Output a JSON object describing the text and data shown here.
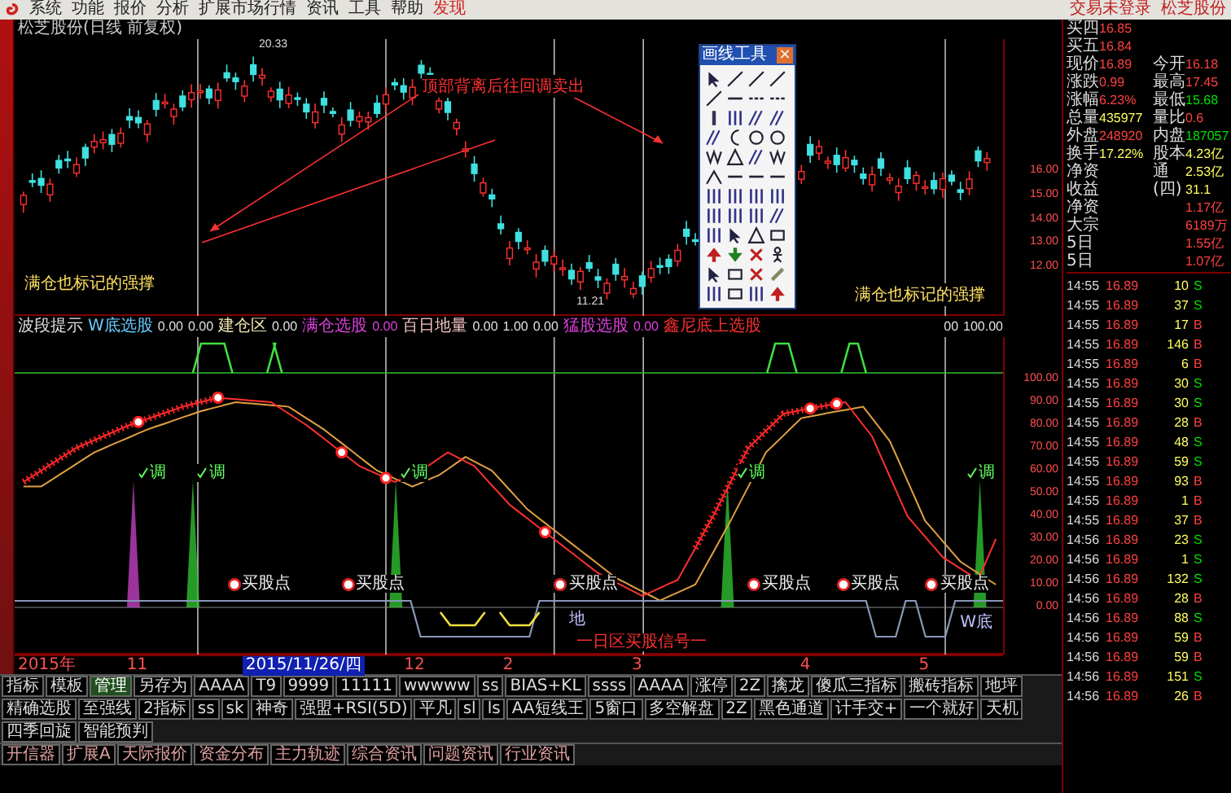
{
  "menu_bar": {
    "items": [
      {
        "label": "系统",
        "highlight": false
      },
      {
        "label": "功能",
        "highlight": false
      },
      {
        "label": "报价",
        "highlight": false
      },
      {
        "label": "分析",
        "highlight": false
      },
      {
        "label": "扩展市场行情",
        "highlight": false
      },
      {
        "label": "资讯",
        "highlight": false
      },
      {
        "label": "工具",
        "highlight": false
      },
      {
        "label": "帮助",
        "highlight": false
      },
      {
        "label": "发现",
        "highlight": true
      }
    ],
    "right": [
      "交易未登录",
      "松芝股份"
    ]
  },
  "price_chart": {
    "title": "松芝股份(日线 前复权)",
    "high_label": "20.33",
    "low_label": "11.21",
    "annotations": [
      {
        "text": "满仓也标记的强撑",
        "kind": "note"
      },
      {
        "text": "顶部背离后往回调卖出",
        "kind": "alert"
      },
      {
        "text": "满仓也标记的强撑",
        "kind": "note"
      }
    ],
    "axis": [
      "16.00",
      "15.00",
      "14.00",
      "13.00",
      "12.00"
    ]
  },
  "indicator_header": [
    {
      "text": "波段提示",
      "kind": "name",
      "color": "#e0e0e0"
    },
    {
      "text": "W底选股",
      "kind": "name",
      "color": "#66ccff"
    },
    {
      "text": "0.00",
      "kind": "value",
      "color": "#e0e0e0"
    },
    {
      "text": "0.00",
      "kind": "value",
      "color": "#e0e0e0"
    },
    {
      "text": "建仓区",
      "kind": "name",
      "color": "#f0e6b0"
    },
    {
      "text": "0.00",
      "kind": "value",
      "color": "#e0e0e0"
    },
    {
      "text": "满仓选股",
      "kind": "name",
      "color": "#e040e0"
    },
    {
      "text": "0.00",
      "kind": "value",
      "color": "#e040e0"
    },
    {
      "text": "百日地量",
      "kind": "name",
      "color": "#f0c0c0"
    },
    {
      "text": "0.00",
      "kind": "value",
      "color": "#e0e0e0"
    },
    {
      "text": "1.00",
      "kind": "value",
      "color": "#e0e0e0"
    },
    {
      "text": "0.00",
      "kind": "value",
      "color": "#e0e0e0"
    },
    {
      "text": "猛股选股",
      "kind": "name",
      "color": "#e040e0"
    },
    {
      "text": "0.00",
      "kind": "value",
      "color": "#e040e0"
    },
    {
      "text": "鑫尼底上选股",
      "kind": "name",
      "color": "#ff3030"
    },
    {
      "text": "00",
      "kind": "value",
      "color": "#e0e0e0"
    },
    {
      "text": "100.00",
      "kind": "value",
      "color": "#e0e0e0"
    }
  ],
  "indicator": {
    "labels": [
      {
        "text": "调",
        "kind": "signal"
      },
      {
        "text": "调",
        "kind": "signal"
      },
      {
        "text": "调",
        "kind": "signal"
      },
      {
        "text": "调",
        "kind": "signal"
      },
      {
        "text": "调",
        "kind": "signal"
      },
      {
        "text": "买股点",
        "kind": "buy"
      },
      {
        "text": "买股点",
        "kind": "buy"
      },
      {
        "text": "买股点",
        "kind": "buy"
      },
      {
        "text": "买股点",
        "kind": "buy"
      },
      {
        "text": "买股点",
        "kind": "buy"
      },
      {
        "text": "买股点",
        "kind": "buy"
      },
      {
        "text": "地",
        "kind": "floor"
      },
      {
        "text": "W底",
        "kind": "floor"
      }
    ],
    "footer": "一日区买股信号一",
    "axis": [
      "100.00",
      "90.00",
      "80.00",
      "70.00",
      "60.00",
      "50.00",
      "40.00",
      "30.00",
      "20.00",
      "10.00",
      "0.00"
    ]
  },
  "date_axis": [
    {
      "text": "2015年",
      "selected": false
    },
    {
      "text": "11",
      "selected": false
    },
    {
      "text": "2015/11/26/四",
      "selected": true
    },
    {
      "text": "12",
      "selected": false
    },
    {
      "text": "2",
      "selected": false
    },
    {
      "text": "3",
      "selected": false
    },
    {
      "text": "4",
      "selected": false
    },
    {
      "text": "5",
      "selected": false
    }
  ],
  "drawing_tools": {
    "title": "画线工具",
    "close": "×"
  },
  "toolbar": [
    {
      "label": "指标",
      "selected": false
    },
    {
      "label": "模板",
      "selected": false
    },
    {
      "label": "管理",
      "selected": true
    },
    {
      "label": "另存为",
      "selected": false
    },
    {
      "label": "AAAA",
      "selected": false
    },
    {
      "label": "T9",
      "selected": false
    },
    {
      "label": "9999",
      "selected": false
    },
    {
      "label": "11111",
      "selected": false
    },
    {
      "label": "wwwww",
      "selected": false
    },
    {
      "label": "ss",
      "selected": false
    },
    {
      "label": "BIAS+KL",
      "selected": false
    },
    {
      "label": "ssss",
      "selected": false
    },
    {
      "label": "AAAA",
      "selected": false
    },
    {
      "label": "涨停",
      "selected": false
    },
    {
      "label": "2Z",
      "selected": false
    },
    {
      "label": "擒龙",
      "selected": false
    },
    {
      "label": "傻瓜三指标",
      "selected": false
    },
    {
      "label": "搬砖指标",
      "selected": false
    },
    {
      "label": "地坪",
      "selected": false
    },
    {
      "label": "精确选股",
      "selected": false
    },
    {
      "label": "至强线",
      "selected": false
    },
    {
      "label": "2指标",
      "selected": false
    },
    {
      "label": "ss",
      "selected": false
    },
    {
      "label": "sk",
      "selected": false
    },
    {
      "label": "神奇",
      "selected": false
    },
    {
      "label": "强盟+RSI(5D)",
      "selected": false
    },
    {
      "label": "平凡",
      "selected": false
    },
    {
      "label": "sl",
      "selected": false
    },
    {
      "label": "ls",
      "selected": false
    },
    {
      "label": "AA短线王",
      "selected": false
    },
    {
      "label": "5窗口",
      "selected": false
    },
    {
      "label": "多空解盘",
      "selected": false
    },
    {
      "label": "2Z",
      "selected": false
    },
    {
      "label": "黑色通道",
      "selected": false
    },
    {
      "label": "计手交+",
      "selected": false
    },
    {
      "label": "一个就好",
      "selected": false
    },
    {
      "label": "天机",
      "selected": false
    },
    {
      "label": "四季回旋",
      "selected": false
    },
    {
      "label": "智能预判",
      "selected": false
    }
  ],
  "bottom_tabs": [
    "开信器",
    "扩展A",
    "天际报价",
    "资金分布",
    "主力轨迹",
    "综合资讯",
    "问题资讯",
    "行业资讯"
  ],
  "quote": [
    {
      "items": [
        {
          "label": "买四",
          "value": "16.85",
          "color": "#ff4040"
        }
      ]
    },
    {
      "items": [
        {
          "label": "买五",
          "value": "16.84",
          "color": "#ff4040"
        }
      ]
    },
    {
      "items": [
        {
          "label": "现价",
          "value": "16.89",
          "color": "#ff4040"
        },
        {
          "label": "今开",
          "value": "16.18",
          "color": "#ff4040"
        }
      ]
    },
    {
      "items": [
        {
          "label": "涨跌",
          "value": "0.99",
          "color": "#ff4040"
        },
        {
          "label": "最高",
          "value": "17.45",
          "color": "#ff4040"
        }
      ]
    },
    {
      "items": [
        {
          "label": "涨幅",
          "value": "6.23%",
          "color": "#ff4040"
        },
        {
          "label": "最低",
          "value": "15.68",
          "color": "#00e000"
        }
      ]
    },
    {
      "items": [
        {
          "label": "总量",
          "value": "435977",
          "color": "#ffff60"
        },
        {
          "label": "量比",
          "value": "0.6",
          "color": "#ff4040"
        }
      ]
    },
    {
      "items": [
        {
          "label": "外盘",
          "value": "248920",
          "color": "#ff4040"
        },
        {
          "label": "内盘",
          "value": "187057",
          "color": "#00e000"
        }
      ]
    },
    {
      "items": [
        {
          "label": "换手",
          "value": "17.22%",
          "color": "#ffff60"
        },
        {
          "label": "股本",
          "value": "4.23亿",
          "color": "#ffff60"
        }
      ]
    },
    {
      "items": [
        {
          "label": "净资"
        },
        {
          "label": "通",
          "value": "2.53亿",
          "color": "#ffff60"
        }
      ]
    },
    {
      "items": [
        {
          "label": "收益"
        },
        {
          "label": "(四)",
          "value": "31.1",
          "color": "#ffff60"
        }
      ]
    },
    {
      "items": [
        {
          "label": "净资"
        },
        {
          "value": "1.17亿",
          "color": "#ff4040"
        }
      ]
    },
    {
      "items": [
        {
          "label": "大宗"
        },
        {
          "value": "6189万",
          "color": "#ff4040"
        }
      ]
    },
    {
      "items": [
        {
          "label": "5日"
        },
        {
          "value": "1.55亿",
          "color": "#ff4040"
        }
      ]
    },
    {
      "items": [
        {
          "label": "5日"
        },
        {
          "value": "1.07亿",
          "color": "#ff4040"
        }
      ]
    }
  ],
  "ticks": [
    {
      "time": "14:55",
      "price": "16.89",
      "volume": "10",
      "side": "S",
      "buy": false
    },
    {
      "time": "14:55",
      "price": "16.89",
      "volume": "37",
      "side": "S",
      "buy": false
    },
    {
      "time": "14:55",
      "price": "16.89",
      "volume": "17",
      "side": "B",
      "buy": true
    },
    {
      "time": "14:55",
      "price": "16.89",
      "volume": "146",
      "side": "B",
      "buy": true
    },
    {
      "time": "14:55",
      "price": "16.89",
      "volume": "6",
      "side": "B",
      "buy": true
    },
    {
      "time": "14:55",
      "price": "16.89",
      "volume": "30",
      "side": "S",
      "buy": false
    },
    {
      "time": "14:55",
      "price": "16.89",
      "volume": "30",
      "side": "S",
      "buy": false
    },
    {
      "time": "14:55",
      "price": "16.89",
      "volume": "28",
      "side": "B",
      "buy": true
    },
    {
      "time": "14:55",
      "price": "16.89",
      "volume": "48",
      "side": "S",
      "buy": false
    },
    {
      "time": "14:55",
      "price": "16.89",
      "volume": "59",
      "side": "S",
      "buy": false
    },
    {
      "time": "14:55",
      "price": "16.89",
      "volume": "93",
      "side": "B",
      "buy": true
    },
    {
      "time": "14:55",
      "price": "16.89",
      "volume": "1",
      "side": "B",
      "buy": true
    },
    {
      "time": "14:55",
      "price": "16.89",
      "volume": "37",
      "side": "B",
      "buy": true
    },
    {
      "time": "14:56",
      "price": "16.89",
      "volume": "23",
      "side": "S",
      "buy": false
    },
    {
      "time": "14:56",
      "price": "16.89",
      "volume": "1",
      "side": "S",
      "buy": false
    },
    {
      "time": "14:56",
      "price": "16.89",
      "volume": "132",
      "side": "S",
      "buy": false
    },
    {
      "time": "14:56",
      "price": "16.89",
      "volume": "28",
      "side": "B",
      "buy": true
    },
    {
      "time": "14:56",
      "price": "16.89",
      "volume": "88",
      "side": "S",
      "buy": false
    },
    {
      "time": "14:56",
      "price": "16.89",
      "volume": "59",
      "side": "B",
      "buy": true
    },
    {
      "time": "14:56",
      "price": "16.89",
      "volume": "59",
      "side": "B",
      "buy": true
    },
    {
      "time": "14:56",
      "price": "16.89",
      "volume": "151",
      "side": "S",
      "buy": false
    },
    {
      "time": "14:56",
      "price": "16.89",
      "volume": "26",
      "side": "B",
      "buy": true
    }
  ]
}
